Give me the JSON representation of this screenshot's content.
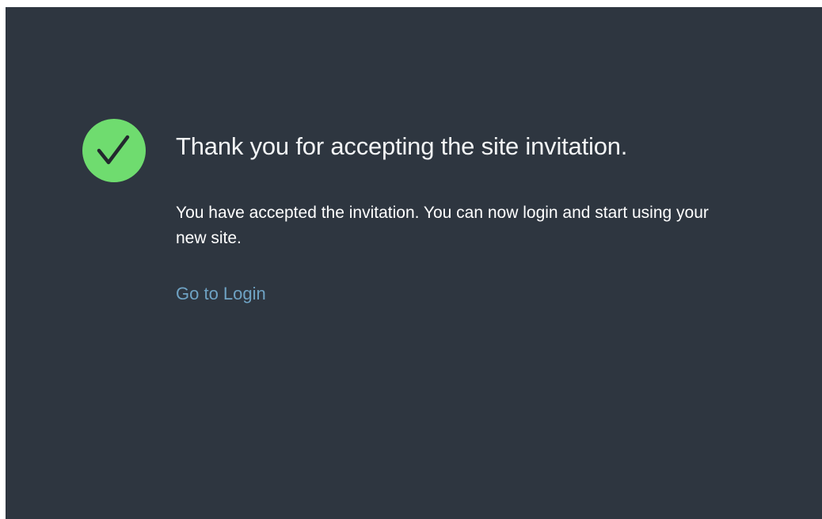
{
  "confirmation": {
    "title": "Thank you for accepting the site invitation.",
    "message": "You have accepted the invitation. You can now login and start using your new site.",
    "login_link": "Go to Login",
    "success_icon": "check-icon"
  },
  "colors": {
    "panel_background": "#2e3640",
    "success_green": "#6fdc6f",
    "link_blue": "#6fa3c4"
  }
}
